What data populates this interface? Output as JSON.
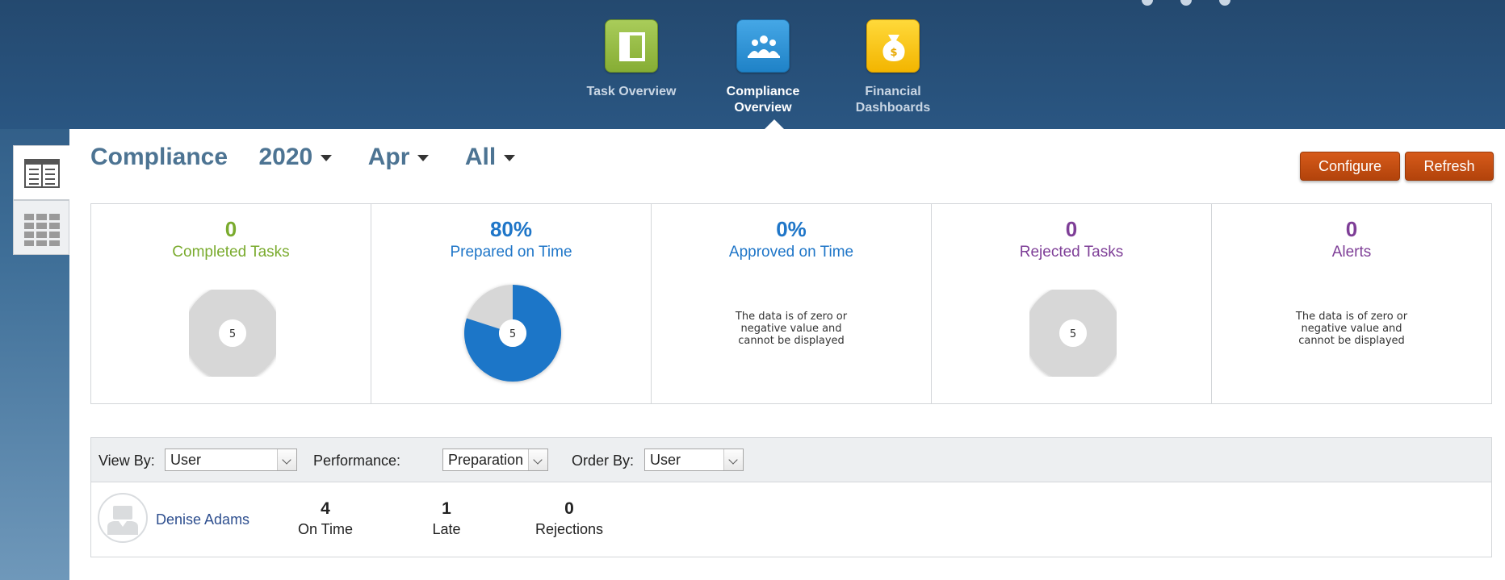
{
  "nav": {
    "items": [
      {
        "label": "Task Overview",
        "icon": "task-overview-icon"
      },
      {
        "label": "Compliance Overview",
        "icon": "compliance-overview-icon",
        "active": true
      },
      {
        "label": "Financial Dashboards",
        "icon": "financial-dashboards-icon"
      }
    ]
  },
  "header": {
    "title": "Compliance",
    "year": "2020",
    "month": "Apr",
    "scope": "All",
    "configure_label": "Configure",
    "refresh_label": "Refresh"
  },
  "metrics": [
    {
      "value": "0",
      "label": "Completed Tasks",
      "color": "#7aab2e",
      "donut": {
        "center": "5",
        "fill_fraction": 0
      }
    },
    {
      "value": "80%",
      "label": "Prepared on Time",
      "color": "#1f76c8",
      "donut": {
        "center": "5",
        "fill_fraction": 0.8
      }
    },
    {
      "value": "0%",
      "label": "Approved on Time",
      "color": "#1f76c8",
      "message": "The data is of zero or negative value and cannot be displayed"
    },
    {
      "value": "0",
      "label": "Rejected Tasks",
      "color": "#7e3e97",
      "donut": {
        "center": "5",
        "fill_fraction": 0
      }
    },
    {
      "value": "0",
      "label": "Alerts",
      "color": "#7e3e97",
      "message": "The data is of zero or negative value and cannot be displayed"
    }
  ],
  "filters": {
    "view_by_label": "View By:",
    "view_by_value": "User",
    "performance_label": "Performance:",
    "performance_value": "Preparation",
    "order_by_label": "Order By:",
    "order_by_value": "User"
  },
  "users": [
    {
      "name": "Denise Adams",
      "on_time": "4",
      "on_time_label": "On Time",
      "late": "1",
      "late_label": "Late",
      "rejections": "0",
      "rejections_label": "Rejections"
    }
  ],
  "colors": {
    "accent_button": "#c04d12",
    "donut_blue": "#1f76c8",
    "donut_grey": "#d7d7d7"
  }
}
